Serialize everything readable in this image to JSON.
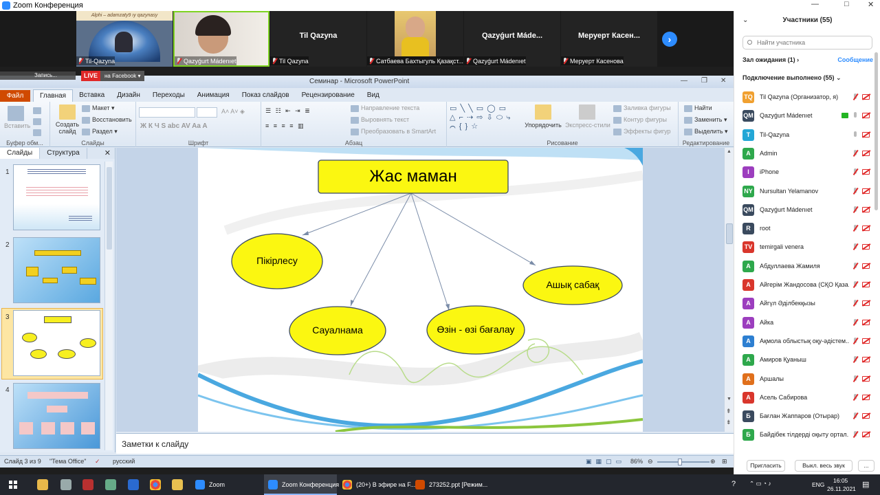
{
  "zoom": {
    "title": "Zoom Конференция"
  },
  "video_strip": {
    "tiles": [
      {
        "name": "Til-Qazyna",
        "banner": "Alphi – adamzaty9 ıy qazynasy"
      },
      {
        "name": "Qazyǵurt Mádenıet"
      },
      {
        "name": "Til Qazyna",
        "center": "Til Qazyna"
      },
      {
        "name": "Сатбаева Бахтыгуль Қазақст..."
      },
      {
        "name": "Qazyǵurt Mádenıet",
        "center": "Qazyǵurt Máde..."
      },
      {
        "name": "Меруерт Касенова",
        "center": "Меруерт Касен..."
      }
    ],
    "next_label": "›"
  },
  "recording": {
    "label": "Запись...",
    "live": "LIVE",
    "platform": "на Facebook"
  },
  "ppt": {
    "title": "Семинар - Microsoft PowerPoint",
    "file_tab": "Файл",
    "tabs": [
      "Главная",
      "Вставка",
      "Дизайн",
      "Переходы",
      "Анимация",
      "Показ слайдов",
      "Рецензирование",
      "Вид"
    ],
    "ribbon": {
      "clipboard": {
        "label": "Буфер обм...",
        "paste": "Вставить"
      },
      "slides": {
        "label": "Слайды",
        "create": "Создать слайд",
        "layout": "Макет",
        "reset": "Восстановить",
        "section": "Раздел"
      },
      "font": {
        "label": "Шрифт"
      },
      "paragraph": {
        "label": "Абзац",
        "direction": "Направление текста",
        "align": "Выровнять текст",
        "smartart": "Преобразовать в SmartArt"
      },
      "drawing": {
        "label": "Рисование",
        "arrange": "Упорядочить",
        "styles": "Экспресс-стили",
        "fill": "Заливка фигуры",
        "outline": "Контур фигуры",
        "effects": "Эффекты фигур"
      },
      "editing": {
        "label": "Редактирование",
        "find": "Найти",
        "replace": "Заменить",
        "select": "Выделить"
      }
    },
    "panel_tabs": [
      "Слайды",
      "Структура"
    ],
    "slide_numbers": [
      "1",
      "2",
      "3",
      "4"
    ],
    "slide": {
      "title": "Жас маман",
      "nodes": [
        "Пікірлесу",
        "Сауалнама",
        "Өзін  - өзі бағалау",
        "Ашық сабақ"
      ]
    },
    "notes_placeholder": "Заметки к слайду",
    "status": {
      "slide": "Слайд 3 из 9",
      "theme": "\"Тема Office\"",
      "lang": "русский",
      "zoom": "86%"
    }
  },
  "participants": {
    "title": "Участники (55)",
    "search_placeholder": "Найти участника",
    "waiting": "Зал ожидания (1)",
    "message": "Сообщение",
    "connected": "Подключение выполнено (55)",
    "list": [
      {
        "initials": "TQ",
        "name": "Til Qazyna (Организатор, я)",
        "color": "#f0a030",
        "mic": "cloud",
        "muted": true
      },
      {
        "initials": "QM",
        "name": "Qazyǵurt Mádenıet",
        "color": "#3a4a5e",
        "mic": "on",
        "share": true
      },
      {
        "initials": "T",
        "name": "Til-Qazyna",
        "color": "#23a7d6",
        "mic": "on"
      },
      {
        "initials": "A",
        "name": "Admin",
        "color": "#2ea84c",
        "muted": true
      },
      {
        "initials": "I",
        "name": "iPhone",
        "color": "#9c3ebe",
        "muted": true
      },
      {
        "initials": "NY",
        "name": "Nursultan Yelamanov",
        "color": "#2ea84c",
        "muted": true
      },
      {
        "initials": "QM",
        "name": "Qazyǵurt Mádenıet",
        "color": "#3a4a5e",
        "muted": true
      },
      {
        "initials": "R",
        "name": "root",
        "color": "#3a4a5e",
        "muted": true
      },
      {
        "initials": "TV",
        "name": "temirgali venera",
        "color": "#d9362c",
        "muted": true
      },
      {
        "initials": "А",
        "name": "Абдуллаева Жамиля",
        "color": "#2ea84c",
        "muted": true
      },
      {
        "initials": "А",
        "name": "Айгерім Жандосова (СҚО Қаза...",
        "color": "#d9362c",
        "muted": true
      },
      {
        "initials": "А",
        "name": "Айгүл Әділбекқызы",
        "color": "#9c3ebe",
        "muted": true
      },
      {
        "initials": "А",
        "name": "Айка",
        "color": "#9c3ebe",
        "muted": true
      },
      {
        "initials": "А",
        "name": "Ақмола облыстық оқу-әдістем...",
        "color": "#2d7fd1",
        "muted": true
      },
      {
        "initials": "А",
        "name": "Амиров Қуаныш",
        "color": "#2ea84c",
        "muted": true
      },
      {
        "initials": "А",
        "name": "Аршалы",
        "color": "#e0701c",
        "muted": true
      },
      {
        "initials": "А",
        "name": "Асель Сабирова",
        "color": "#d9362c",
        "muted": true
      },
      {
        "initials": "Б",
        "name": "Бағлан Жаппаров (Отырар)",
        "color": "#3a4a5e",
        "muted": true
      },
      {
        "initials": "Б",
        "name": "Байдібек тілдерді оқыту ортал...",
        "color": "#2ea84c",
        "muted": true
      }
    ],
    "invite": "Пригласить",
    "mute_all": "Выкл. весь звук",
    "more": "..."
  },
  "taskbar": {
    "buttons": [
      {
        "label": "Zoom",
        "color": "#2d8cff"
      },
      {
        "label": "Zoom Конференция",
        "color": "#2d8cff",
        "active": true
      },
      {
        "label": "(20+) В эфире на F...",
        "color": "#e8453c"
      },
      {
        "label": "273252.ppt [Режим...",
        "color": "#d04a00"
      }
    ],
    "lang": "ENG",
    "time": "16:05",
    "date": "26.11.2021"
  }
}
